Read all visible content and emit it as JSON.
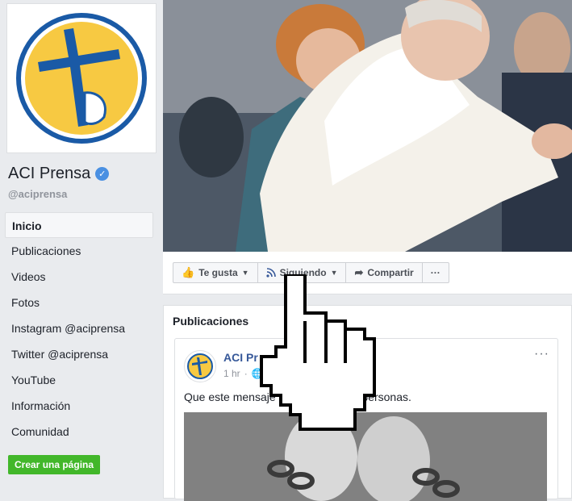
{
  "page": {
    "name": "ACI Prensa",
    "handle": "@aciprensa"
  },
  "nav": {
    "items": [
      {
        "label": "Inicio",
        "active": true
      },
      {
        "label": "Publicaciones"
      },
      {
        "label": "Videos"
      },
      {
        "label": "Fotos"
      },
      {
        "label": "Instagram @aciprensa"
      },
      {
        "label": "Twitter @aciprensa"
      },
      {
        "label": "YouTube"
      },
      {
        "label": "Información"
      },
      {
        "label": "Comunidad"
      }
    ],
    "create_page": "Crear una página"
  },
  "actions": {
    "like": "Te gusta",
    "following": "Siguiendo",
    "share": "Compartir",
    "more": "···"
  },
  "posts": {
    "title": "Publicaciones",
    "post": {
      "author": "ACI Pr",
      "time": "1 hr",
      "text_before": "Que este mensaje l",
      "text_after": "personas.",
      "more": "···"
    }
  },
  "colors": {
    "link": "#365899",
    "logo_yellow": "#f7c942",
    "logo_blue": "#1a5aa6",
    "create_green": "#42b72a"
  }
}
